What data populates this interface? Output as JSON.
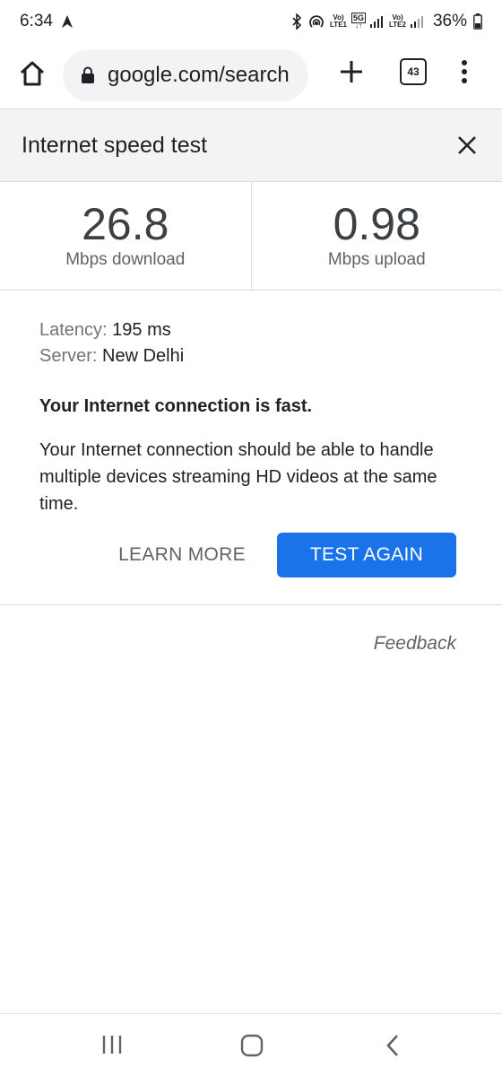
{
  "status_bar": {
    "time": "6:34",
    "sim1_label": "Vo)\nLTE1",
    "network_label": "5G",
    "sim2_label": "Vo)\nLTE2",
    "battery": "36%"
  },
  "toolbar": {
    "url": "google.com/search",
    "tab_count": "43"
  },
  "speed_test": {
    "title": "Internet speed test",
    "download_value": "26.8",
    "download_label": "Mbps download",
    "upload_value": "0.98",
    "upload_label": "Mbps upload",
    "latency_key": "Latency:",
    "latency_value": "195 ms",
    "server_key": "Server:",
    "server_value": "New Delhi",
    "verdict": "Your Internet connection is fast.",
    "description": "Your Internet connection should be able to handle multiple devices streaming HD videos at the same time.",
    "learn_more_label": "LEARN MORE",
    "test_again_label": "TEST AGAIN",
    "feedback_label": "Feedback"
  },
  "colors": {
    "accent": "#1a73e8",
    "header_bg": "#f1f3f4"
  }
}
